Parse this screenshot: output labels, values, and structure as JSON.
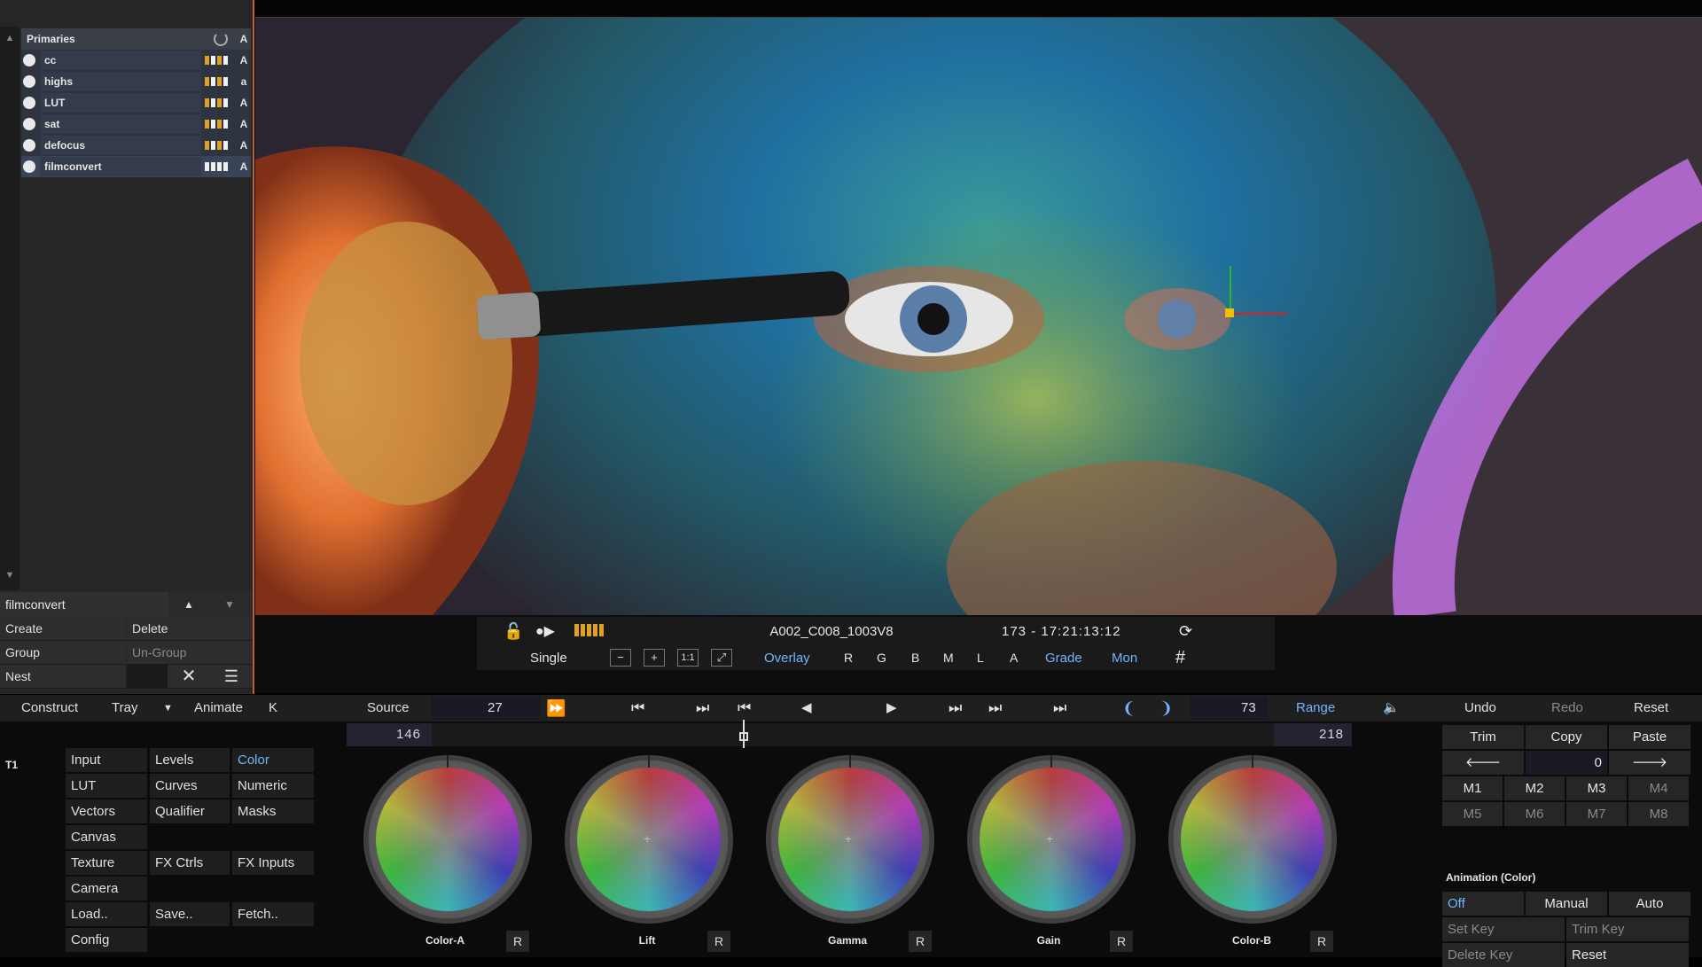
{
  "tree": {
    "header": "Primaries",
    "header_flag": "A",
    "items": [
      {
        "name": "cc",
        "flag": "A"
      },
      {
        "name": "highs",
        "flag": "a"
      },
      {
        "name": "LUT",
        "flag": "A"
      },
      {
        "name": "sat",
        "flag": "A"
      },
      {
        "name": "defocus",
        "flag": "A"
      },
      {
        "name": "filmconvert",
        "flag": "A"
      }
    ]
  },
  "layer_panel": {
    "current_name": "filmconvert",
    "create": "Create",
    "delete": "Delete",
    "group": "Group",
    "ungroup": "Un-Group",
    "nest": "Nest"
  },
  "transport": {
    "clip_name": "A002_C008_1003V8",
    "range_text": "173  -  17:21:13:12",
    "single": "Single",
    "overlay": "Overlay",
    "channels": [
      "R",
      "G",
      "B",
      "M",
      "L",
      "A"
    ],
    "grade": "Grade",
    "mon": "Mon",
    "zoom_boxes": [
      "−",
      "+",
      "1:1",
      "⤢"
    ]
  },
  "menustrip": {
    "construct": "Construct",
    "tray": "Tray",
    "animate": "Animate",
    "k": "K",
    "source": "Source",
    "frame_step": "27",
    "frame_count": "73",
    "range": "Range",
    "undo": "Undo",
    "redo": "Redo",
    "reset": "Reset"
  },
  "timeline": {
    "start": "146",
    "end": "218",
    "playhead_fraction": 0.37
  },
  "track_label": "T1",
  "tabs": {
    "col1": [
      "Input",
      "LUT",
      "Vectors",
      "Canvas",
      "Texture",
      "Camera",
      "Load..",
      "Config"
    ],
    "col2": [
      "Levels",
      "Curves",
      "Qualifier",
      "",
      "FX Ctrls",
      "",
      "Save..",
      ""
    ],
    "col3": [
      "Color",
      "Numeric",
      "Masks",
      "",
      "FX Inputs",
      "",
      "Fetch..",
      ""
    ],
    "active": "Color"
  },
  "wheels": [
    {
      "label": "Color-A",
      "r": "R"
    },
    {
      "label": "Lift",
      "r": "R"
    },
    {
      "label": "Gamma",
      "r": "R"
    },
    {
      "label": "Gain",
      "r": "R"
    },
    {
      "label": "Color-B",
      "r": "R"
    }
  ],
  "right_panel": {
    "trim": "Trim",
    "copy": "Copy",
    "paste": "Paste",
    "key_value": "0",
    "memories": [
      "M1",
      "M2",
      "M3",
      "M4",
      "M5",
      "M6",
      "M7",
      "M8"
    ],
    "animation_title": "Animation (Color)",
    "off": "Off",
    "manual": "Manual",
    "auto": "Auto",
    "set_key": "Set Key",
    "trim_key": "Trim Key",
    "delete_key": "Delete Key",
    "reset": "Reset"
  },
  "colors": {
    "accent": "#6fb6ff",
    "tree_bar": "#e0a020",
    "panel_border": "#c0602a"
  }
}
